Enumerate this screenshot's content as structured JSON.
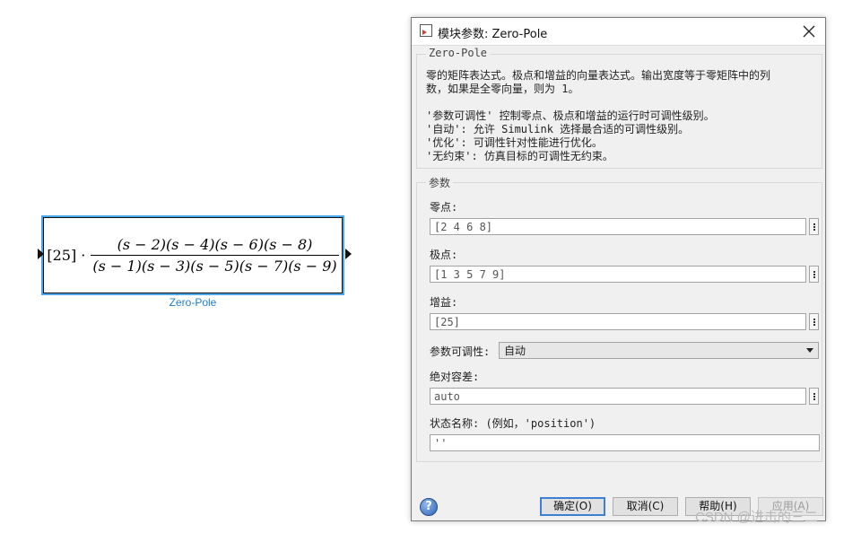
{
  "block": {
    "gain_text": "[25] ·",
    "numerator": "(s − 2)(s − 4)(s − 6)(s − 8)",
    "denominator": "(s − 1)(s − 3)(s − 5)(s − 7)(s − 9)",
    "label": "Zero-Pole",
    "colors": {
      "selection": "#4aa8ea",
      "label": "#1f7fd0"
    }
  },
  "dialog": {
    "title": "模块参数: Zero-Pole",
    "section_title": "Zero-Pole",
    "description": {
      "line1": "零的矩阵表达式。极点和增益的向量表达式。输出宽度等于零矩阵中的列",
      "line2": "数，如果是全零向量，则为 1。",
      "line3": "'参数可调性' 控制零点、极点和增益的运行时可调性级别。",
      "line4": "'自动': 允许 Simulink 选择最合适的可调性级别。",
      "line5": "'优化': 可调性针对性能进行优化。",
      "line6": "'无约束': 仿真目标的可调性无约束。"
    },
    "params_title": "参数",
    "zeros": {
      "label": "零点:",
      "value": "[2 4 6 8]"
    },
    "poles": {
      "label": "极点:",
      "value": "[1 3 5 7 9]"
    },
    "gain": {
      "label": "增益:",
      "value": "[25]"
    },
    "tunability": {
      "label": "参数可调性:",
      "value": "自动"
    },
    "abs_tol": {
      "label": "绝对容差:",
      "value": "auto"
    },
    "state_name": {
      "label": "状态名称: (例如，'position')",
      "value": "''"
    },
    "buttons": {
      "ok": "确定(O)",
      "cancel": "取消(C)",
      "help": "帮助(H)",
      "apply": "应用(A)"
    }
  },
  "watermark": "CSDN @进击的三二"
}
